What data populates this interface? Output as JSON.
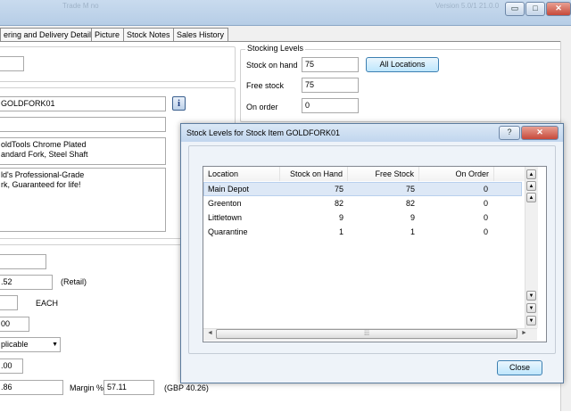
{
  "window": {
    "faint_left": "Trade M no",
    "faint_right": "Version  5.0/1 21.0.0",
    "minimize": "▭",
    "restore": "□",
    "close": "✕"
  },
  "tabs": [
    "ering and Delivery Details",
    "Picture",
    "Stock Notes",
    "Sales History"
  ],
  "left": {
    "code": "GOLDFORK01",
    "info": "i",
    "desc1_l1": "oldTools Chrome Plated",
    "desc1_l2": "andard Fork, Steel Shaft",
    "desc2_l1": "ld's Professional-Grade",
    "desc2_l2": "rk, Guaranteed for life!",
    "price": ".52",
    "price_note": "(Retail)",
    "unit": "EACH",
    "qty": "00",
    "applicable": "plicable",
    "cost": ".00",
    "margin_value_left": ".86",
    "margin_label": "Margin %",
    "margin_value": "57.11",
    "gbp": "(GBP 40.26)"
  },
  "stock": {
    "group_title": "Stocking Levels",
    "on_hand_label": "Stock on hand",
    "on_hand": "75",
    "all_locations": "All Locations",
    "free_label": "Free stock",
    "free": "75",
    "on_order_label": "On order",
    "on_order": "0"
  },
  "dialog": {
    "title": "Stock Levels for Stock Item GOLDFORK01",
    "help": "?",
    "close_x": "✕",
    "columns": [
      "Location",
      "Stock on Hand",
      "Free Stock",
      "On Order"
    ],
    "rows": [
      [
        "Main Depot",
        "75",
        "75",
        "0"
      ],
      [
        "Greenton",
        "82",
        "82",
        "0"
      ],
      [
        "Littletown",
        "9",
        "9",
        "0"
      ],
      [
        "Quarantine",
        "1",
        "1",
        "0"
      ]
    ],
    "close_button": "Close"
  }
}
